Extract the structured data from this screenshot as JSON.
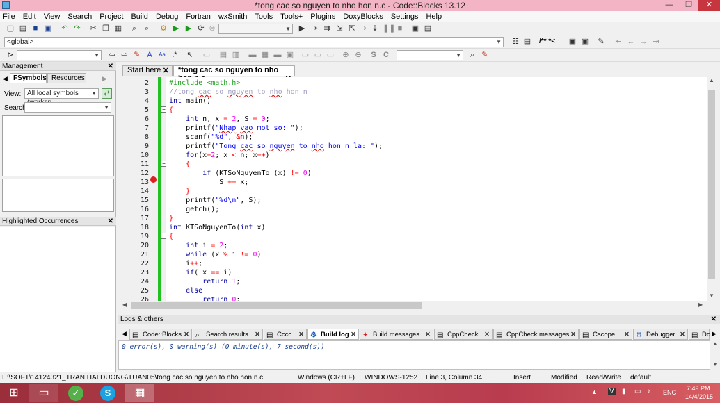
{
  "window": {
    "title": "*tong cac so nguyen to nho hon n.c - Code::Blocks 13.12"
  },
  "menu": [
    "File",
    "Edit",
    "View",
    "Search",
    "Project",
    "Build",
    "Debug",
    "Fortran",
    "wxSmith",
    "Tools",
    "Tools+",
    "Plugins",
    "DoxyBlocks",
    "Settings",
    "Help"
  ],
  "toolbar": {
    "scope_value": "<global>",
    "comment_block": "/** *<"
  },
  "management": {
    "title": "Management",
    "tabs": [
      "FSymbols",
      "Resources"
    ],
    "view_label": "View:",
    "view_value": "All local symbols (worksp",
    "search_label": "Search:",
    "highlighted_title": "Highlighted Occurrences"
  },
  "editor": {
    "tabs": [
      "Start here",
      "*tong cac so nguyen to nho hon n.c"
    ],
    "line_numbers": [
      "2",
      "3",
      "4",
      "5",
      "6",
      "7",
      "8",
      "9",
      "10",
      "11",
      "12",
      "13",
      "14",
      "15",
      "16",
      "17",
      "18",
      "19",
      "20",
      "21",
      "22",
      "23",
      "24",
      "25",
      "26"
    ],
    "breakpoint_line": "13"
  },
  "logs": {
    "title": "Logs & others",
    "tabs": [
      "Code::Blocks",
      "Search results",
      "Cccc",
      "Build log",
      "Build messages",
      "CppCheck",
      "CppCheck messages",
      "Cscope",
      "Debugger",
      "Dc"
    ],
    "active_tab": "Build log",
    "output": "0 error(s), 0 warning(s) (0 minute(s), 7 second(s))"
  },
  "status": {
    "path": "E:\\SOFT\\14124321_TRAN HAI DUONG\\TUAN05\\tong cac so nguyen to nho hon n.c",
    "eol": "Windows (CR+LF)",
    "encoding": "WINDOWS-1252",
    "position": "Line 3, Column 34",
    "mode": "Insert",
    "modified": "Modified",
    "rw": "Read/Write",
    "lang": "default"
  },
  "taskbar": {
    "lang": "ENG",
    "time": "7:49 PM",
    "date": "14/4/2015"
  }
}
